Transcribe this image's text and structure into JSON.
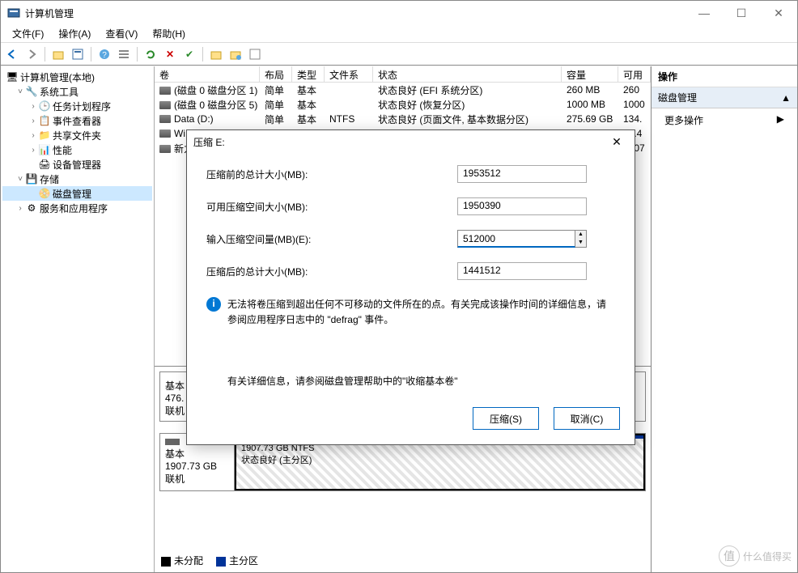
{
  "window": {
    "title": "计算机管理",
    "controls": {
      "min": "—",
      "max": "☐",
      "close": "✕"
    }
  },
  "menu": {
    "file": "文件(F)",
    "action": "操作(A)",
    "view": "查看(V)",
    "help": "帮助(H)"
  },
  "tree": {
    "root": "计算机管理(本地)",
    "systools": "系统工具",
    "scheduler": "任务计划程序",
    "eventviewer": "事件查看器",
    "shared": "共享文件夹",
    "perf": "性能",
    "devmgr": "设备管理器",
    "storage": "存储",
    "diskmgmt": "磁盘管理",
    "services": "服务和应用程序"
  },
  "grid": {
    "headers": {
      "vol": "卷",
      "layout": "布局",
      "type": "类型",
      "fs": "文件系统",
      "status": "状态",
      "cap": "容量",
      "free": "可用"
    },
    "rows": [
      {
        "vol": "(磁盘 0 磁盘分区 1)",
        "layout": "简单",
        "type": "基本",
        "fs": "",
        "status": "状态良好 (EFI 系统分区)",
        "cap": "260 MB",
        "free": "260"
      },
      {
        "vol": "(磁盘 0 磁盘分区 5)",
        "layout": "简单",
        "type": "基本",
        "fs": "",
        "status": "状态良好 (恢复分区)",
        "cap": "1000 MB",
        "free": "1000"
      },
      {
        "vol": "Data (D:)",
        "layout": "简单",
        "type": "基本",
        "fs": "NTFS",
        "status": "状态良好 (页面文件, 基本数据分区)",
        "cap": "275.69 GB",
        "free": "134."
      },
      {
        "vol": "Wi",
        "layout": "",
        "type": "",
        "fs": "",
        "status": "",
        "cap": "",
        "free": "67.4"
      },
      {
        "vol": "新力",
        "layout": "",
        "type": "",
        "fs": "",
        "status": "",
        "cap": "",
        "free": "1907"
      }
    ]
  },
  "disk_graph": {
    "disk0": {
      "label_line1": "基本",
      "label_line2": "476.",
      "label_line3": "联机"
    },
    "disk1": {
      "label_line1": "基本",
      "label_line2": "1907.73 GB",
      "label_line3": "联机",
      "part_size": "1907.73 GB NTFS",
      "part_status": "状态良好 (主分区)"
    }
  },
  "legend": {
    "unalloc": "未分配",
    "primary": "主分区"
  },
  "actions_pane": {
    "header": "操作",
    "group": "磁盘管理",
    "more": "更多操作"
  },
  "dialog": {
    "title": "压缩 E:",
    "total_before_label": "压缩前的总计大小(MB):",
    "total_before_value": "1953512",
    "avail_label": "可用压缩空间大小(MB):",
    "avail_value": "1950390",
    "amount_label": "输入压缩空间量(MB)(E):",
    "amount_value": "512000",
    "total_after_label": "压缩后的总计大小(MB):",
    "total_after_value": "1441512",
    "info1": "无法将卷压缩到超出任何不可移动的文件所在的点。有关完成该操作时间的详细信息，请参阅应用程序日志中的 \"defrag\" 事件。",
    "info2": "有关详细信息，请参阅磁盘管理帮助中的\"收缩基本卷\"",
    "btn_shrink": "压缩(S)",
    "btn_cancel": "取消(C)"
  },
  "watermark": "什么值得买"
}
